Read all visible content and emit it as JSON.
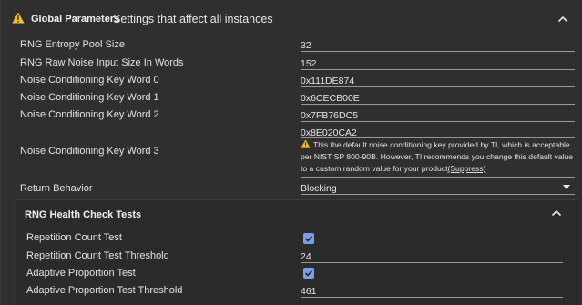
{
  "global_parameters": {
    "title": "Global Parameters",
    "subtitle": "Settings that affect all instances",
    "icon": "warning-icon",
    "collapse_icon": "chevron-up-icon",
    "fields": {
      "rng_entropy_pool_size": {
        "label": "RNG Entropy Pool Size",
        "value": "32"
      },
      "rng_raw_noise_input_size": {
        "label": "RNG Raw Noise Input Size In Words",
        "value": "152"
      },
      "noise_key_word_0": {
        "label": "Noise Conditioning Key Word 0",
        "value": "0x111DE874"
      },
      "noise_key_word_1": {
        "label": "Noise Conditioning Key Word 1",
        "value": "0x6CECB00E"
      },
      "noise_key_word_2": {
        "label": "Noise Conditioning Key Word 2",
        "value": "0x7FB76DC5"
      },
      "noise_key_word_3": {
        "label": "Noise Conditioning Key Word 3",
        "value": "0x8E020CA2"
      },
      "return_behavior": {
        "label": "Return Behavior",
        "value": "Blocking"
      }
    },
    "warning": {
      "text": "This the default noise conditioning key provided by TI, which is acceptable per NIST SP 800-90B. However, TI recommends you change this default value to a custom random value for your product",
      "link_label": "(Suppress)"
    }
  },
  "rng_health_check": {
    "title": "RNG Health Check Tests",
    "collapse_icon": "chevron-up-icon",
    "fields": {
      "repetition_count_test": {
        "label": "Repetition Count Test",
        "checked": true
      },
      "repetition_count_threshold": {
        "label": "Repetition Count Test Threshold",
        "value": "24"
      },
      "adaptive_proportion_test": {
        "label": "Adaptive Proportion Test",
        "checked": true
      },
      "adaptive_proportion_threshold": {
        "label": "Adaptive Proportion Test Threshold",
        "value": "461"
      }
    }
  },
  "colors": {
    "background": "#2f2f2f",
    "warning_yellow": "#f2c230",
    "checkbox_blue": "#7e9ce8",
    "underline": "#9a9a9a"
  }
}
